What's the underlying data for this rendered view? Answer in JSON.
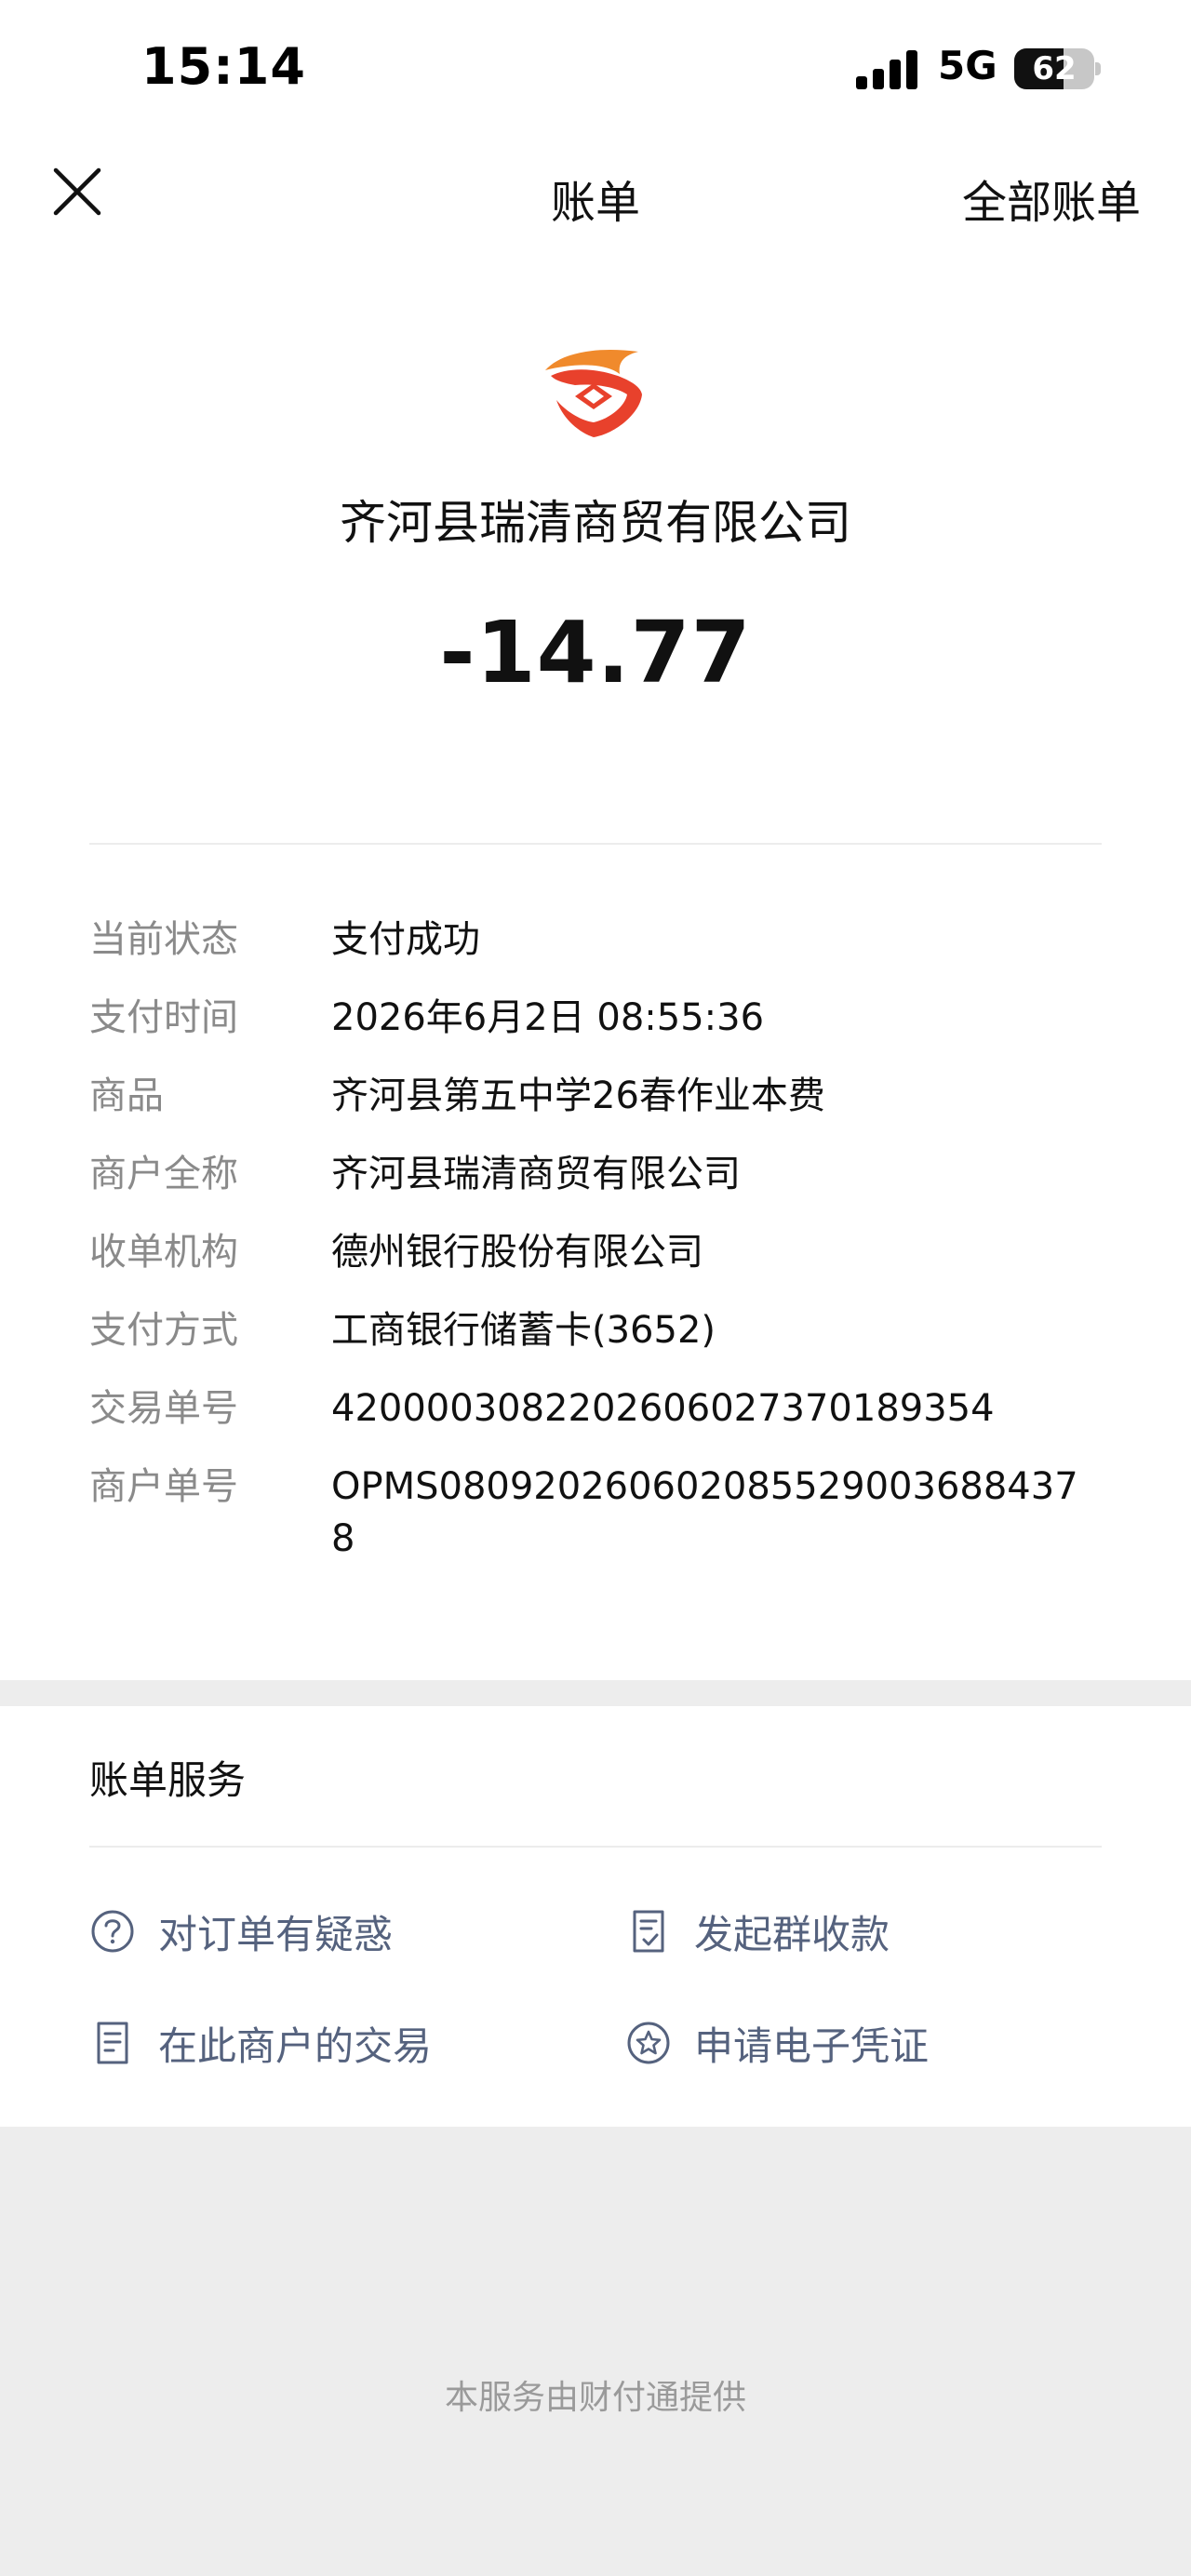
{
  "status_bar": {
    "time": "15:14",
    "network": "5G",
    "battery": "62",
    "battery_level_percent": 62
  },
  "nav": {
    "title": "账单",
    "right_link": "全部账单"
  },
  "header": {
    "merchant": "齐河县瑞清商贸有限公司",
    "amount": "-14.77"
  },
  "details": [
    {
      "label": "当前状态",
      "value": "支付成功"
    },
    {
      "label": "支付时间",
      "value": "2026年6月2日 08:55:36"
    },
    {
      "label": "商品",
      "value": "齐河县第五中学26春作业本费"
    },
    {
      "label": "商户全称",
      "value": "齐河县瑞清商贸有限公司"
    },
    {
      "label": "收单机构",
      "value": "德州银行股份有限公司"
    },
    {
      "label": "支付方式",
      "value": "工商银行储蓄卡(3652)"
    },
    {
      "label": "交易单号",
      "value": "4200003082202606027370189354"
    },
    {
      "label": "商户单号",
      "value": "OPMS080920260602085529003688437 8"
    }
  ],
  "services": {
    "title": "账单服务",
    "items": [
      {
        "label": "对订单有疑惑",
        "icon": "question-circle-icon"
      },
      {
        "label": "发起群收款",
        "icon": "receipt-check-icon"
      },
      {
        "label": "在此商户的交易",
        "icon": "document-list-icon"
      },
      {
        "label": "申请电子凭证",
        "icon": "star-badge-icon"
      }
    ]
  },
  "footer": {
    "text": "本服务由财付通提供"
  },
  "colors": {
    "link": "#55627e",
    "label": "#8a8a8a",
    "logo_red": "#e8412c",
    "logo_orange": "#f08a2c"
  }
}
